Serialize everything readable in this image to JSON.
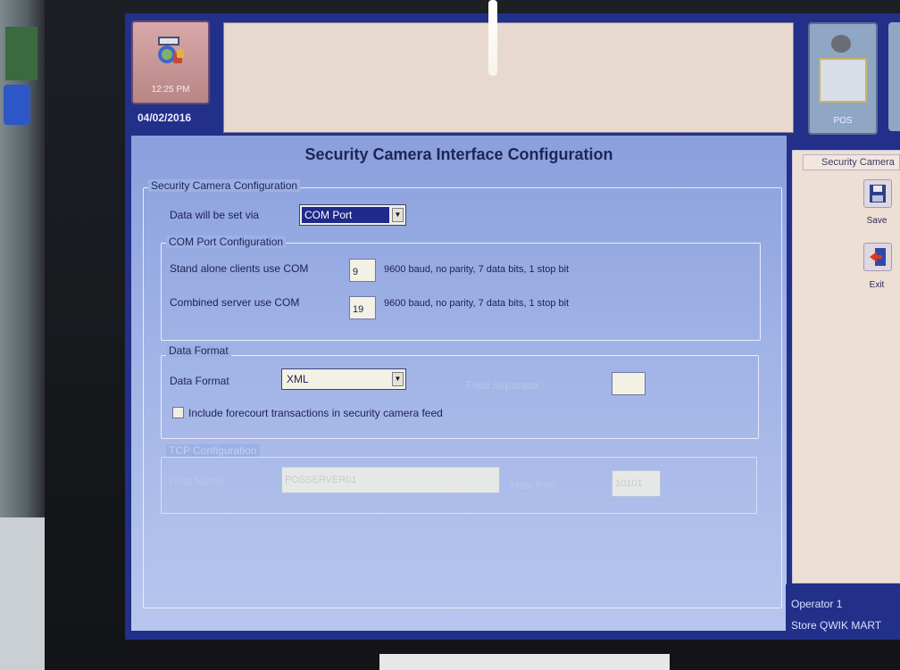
{
  "clock": {
    "time": "12:25 PM",
    "date": "04/02/2016"
  },
  "pos_tile": {
    "label": "POS"
  },
  "window": {
    "title": "Security Camera Interface Configuration"
  },
  "security_camera_group": {
    "legend": "Security Camera Configuration",
    "data_sent_label": "Data will be set via",
    "data_sent_value": "COM Port"
  },
  "com_port_group": {
    "legend": "COM Port Configuration",
    "standalone_label": "Stand alone clients use COM",
    "standalone_value": "9",
    "standalone_desc": "9600 baud, no parity, 7 data bits, 1 stop bit",
    "combined_label": "Combined server use COM",
    "combined_value": "19",
    "combined_desc": "9600 baud, no parity, 7 data bits, 1 stop bit"
  },
  "data_format_group": {
    "legend": "Data Format",
    "format_label": "Data Format",
    "format_value": "XML",
    "field_separator_label": "Field Separator",
    "field_separator_value": "",
    "include_forecourt_label": "Include forecourt transactions in security camera feed",
    "include_forecourt_checked": false
  },
  "tcp_group": {
    "legend": "TCP Configuration",
    "host_label": "Host Name",
    "host_value": "POSSERVER01",
    "port_label": "Host Port",
    "port_value": "10101"
  },
  "side_panel": {
    "title": "Security Camera",
    "save_label": "Save",
    "exit_label": "Exit"
  },
  "status": {
    "operator": "Operator 1",
    "store": "Store QWIK MART"
  },
  "icons": {
    "clock_tile": "clock-app-icon",
    "pos": "pos-terminal-icon",
    "save": "floppy-disk-icon",
    "exit": "exit-door-icon"
  },
  "colors": {
    "screen_frame": "#22308a",
    "panel_top": "#8a9fdc",
    "message_box": "#e8d9cf",
    "side_panel": "#eddfd4"
  }
}
